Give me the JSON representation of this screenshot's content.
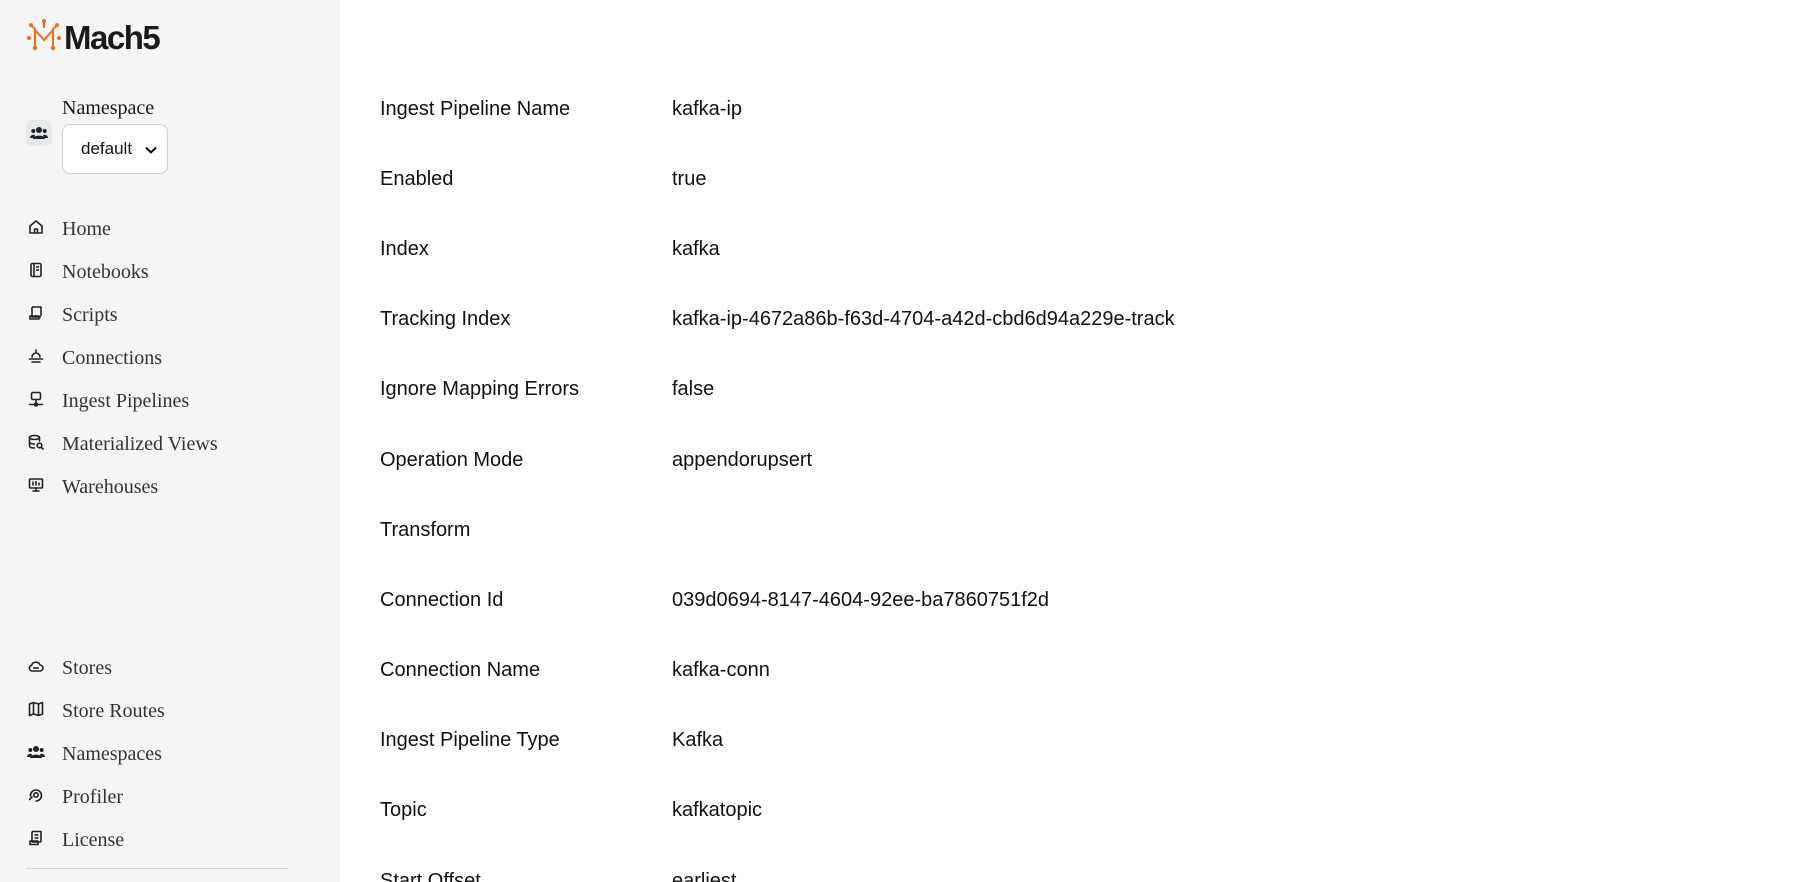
{
  "brand": {
    "name": "Mach5",
    "accent": "#f26b21"
  },
  "namespace": {
    "label": "Namespace",
    "selected": "default"
  },
  "nav_top": [
    {
      "label": "Home",
      "icon": "home-icon"
    },
    {
      "label": "Notebooks",
      "icon": "notebook-icon"
    },
    {
      "label": "Scripts",
      "icon": "script-icon"
    },
    {
      "label": "Connections",
      "icon": "connections-icon"
    },
    {
      "label": "Ingest Pipelines",
      "icon": "pipeline-icon"
    },
    {
      "label": "Materialized Views",
      "icon": "database-search-icon"
    },
    {
      "label": "Warehouses",
      "icon": "warehouse-icon"
    }
  ],
  "nav_bottom": [
    {
      "label": "Stores",
      "icon": "cloud-icon"
    },
    {
      "label": "Store Routes",
      "icon": "map-icon"
    },
    {
      "label": "Namespaces",
      "icon": "users-icon"
    },
    {
      "label": "Profiler",
      "icon": "profiler-icon"
    },
    {
      "label": "License",
      "icon": "license-icon"
    }
  ],
  "details": [
    {
      "label": "Ingest Pipeline Name",
      "value": "kafka-ip"
    },
    {
      "label": "Enabled",
      "value": "true"
    },
    {
      "label": "Index",
      "value": "kafka"
    },
    {
      "label": "Tracking Index",
      "value": "kafka-ip-4672a86b-f63d-4704-a42d-cbd6d94a229e-track"
    },
    {
      "label": "Ignore Mapping Errors",
      "value": "false"
    },
    {
      "label": "Operation Mode",
      "value": "appendorupsert"
    },
    {
      "label": "Transform",
      "value": ""
    },
    {
      "label": "Connection Id",
      "value": "039d0694-8147-4604-92ee-ba7860751f2d"
    },
    {
      "label": "Connection Name",
      "value": "kafka-conn"
    },
    {
      "label": "Ingest Pipeline Type",
      "value": "Kafka"
    },
    {
      "label": "Topic",
      "value": "kafkatopic"
    },
    {
      "label": "Start Offset",
      "value": "earliest"
    }
  ]
}
